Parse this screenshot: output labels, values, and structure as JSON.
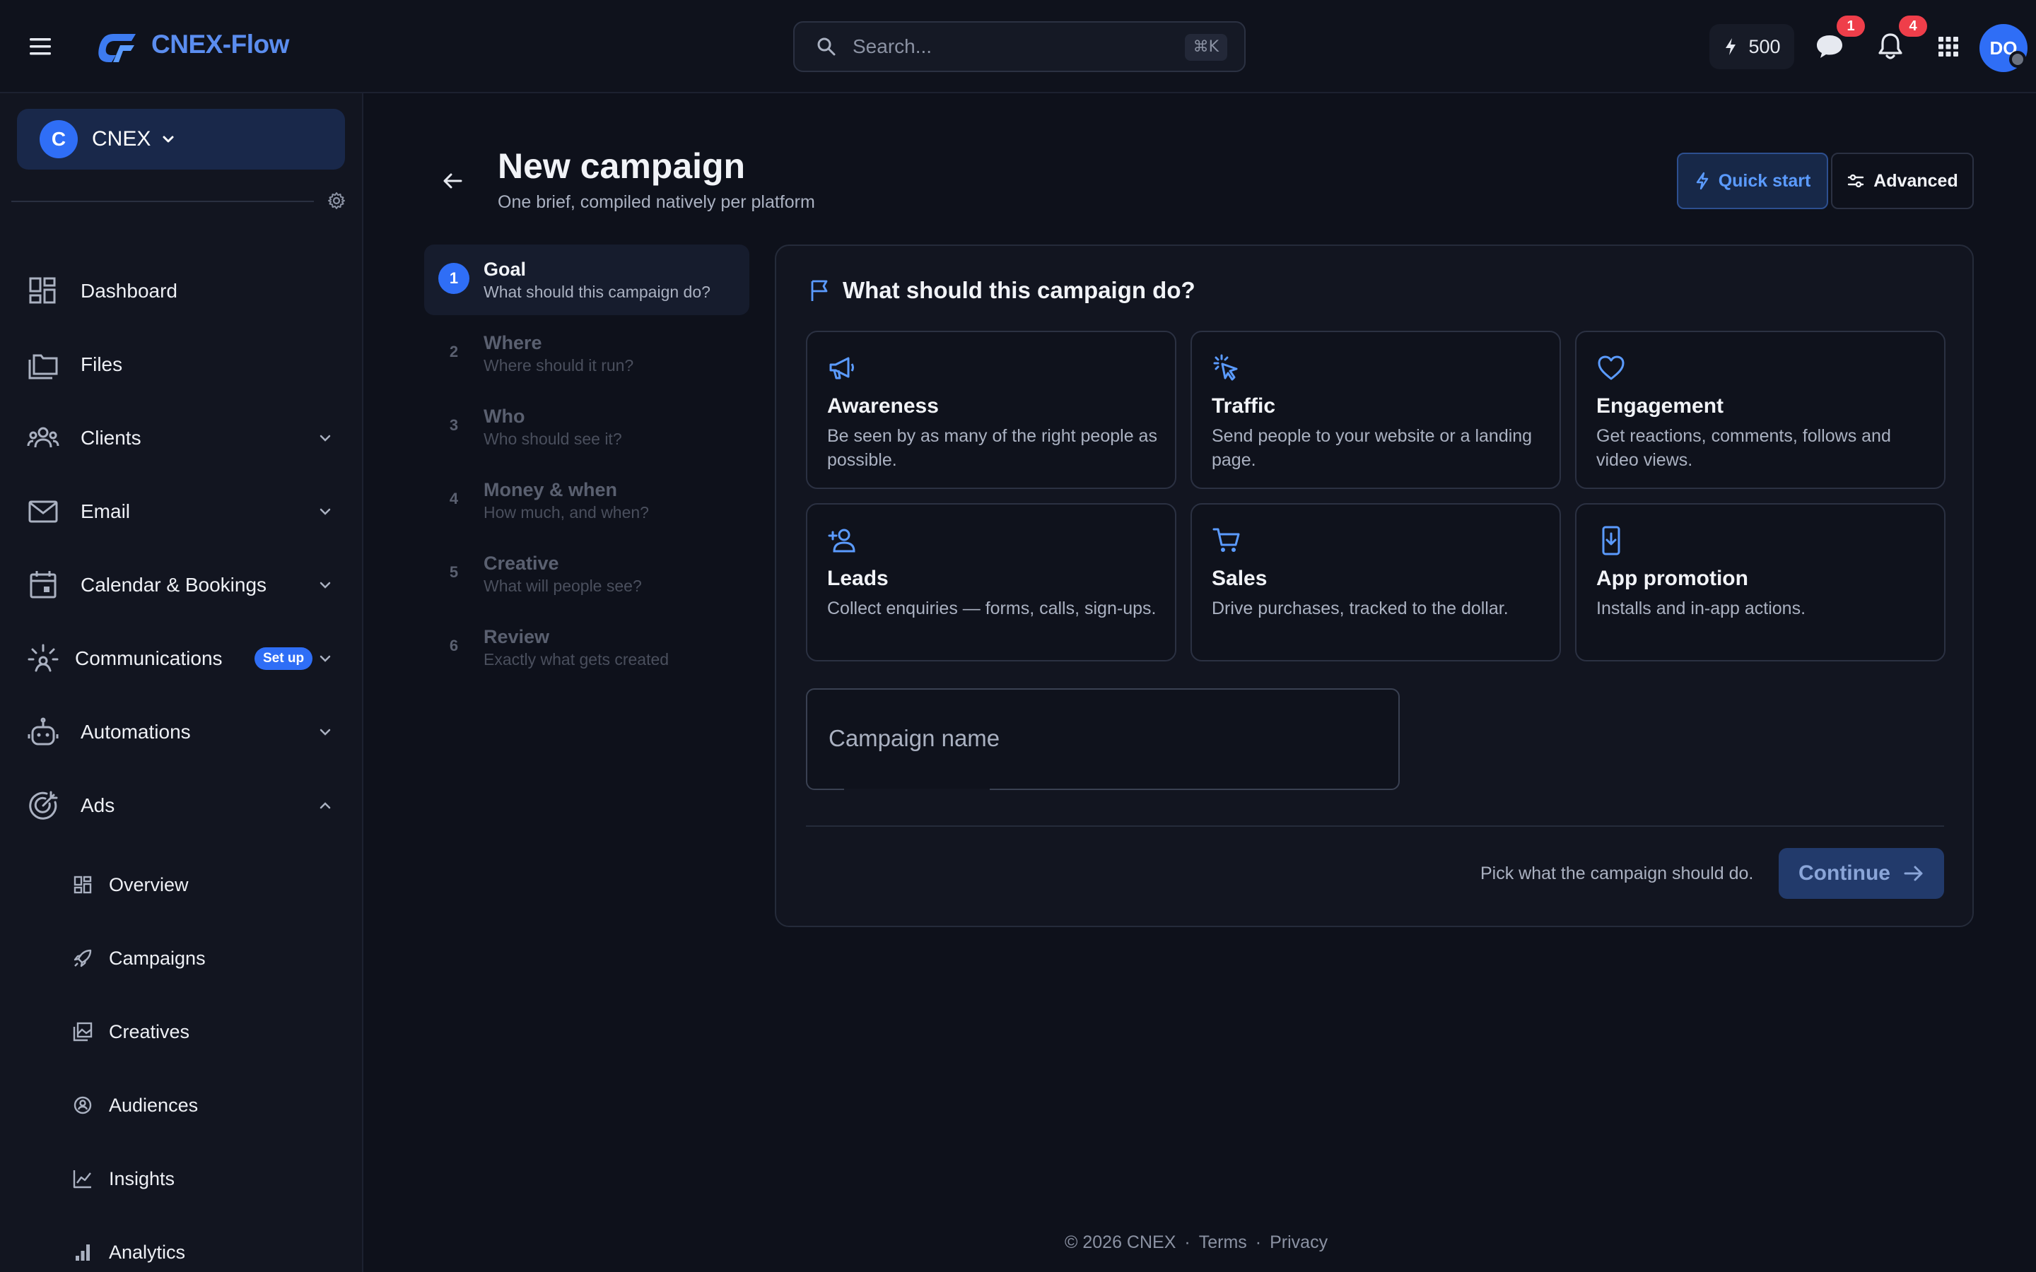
{
  "app": {
    "name": "CNEX-Flow",
    "brand_color": "#5b8def",
    "accent_color": "#2f6ef6"
  },
  "topbar": {
    "search_placeholder": "Search...",
    "search_shortcut": "⌘K",
    "credits": "500",
    "messages_badge": "1",
    "notifications_badge": "4",
    "user_initials": "DO"
  },
  "sidebar": {
    "org": {
      "initial": "C",
      "name": "CNEX"
    },
    "items": [
      {
        "label": "Dashboard",
        "icon": "dashboard-icon"
      },
      {
        "label": "Files",
        "icon": "folders-icon"
      },
      {
        "label": "Clients",
        "icon": "users-icon",
        "expandable": true
      },
      {
        "label": "Email",
        "icon": "mail-icon",
        "expandable": true
      },
      {
        "label": "Calendar & Bookings",
        "icon": "calendar-icon",
        "expandable": true
      },
      {
        "label": "Communications",
        "icon": "broadcast-icon",
        "expandable": true,
        "badge": "Set up"
      },
      {
        "label": "Automations",
        "icon": "robot-icon",
        "expandable": true
      },
      {
        "label": "Ads",
        "icon": "target-icon",
        "expanded": true
      }
    ],
    "ads_sub": [
      {
        "label": "Overview",
        "icon": "grid-icon"
      },
      {
        "label": "Campaigns",
        "icon": "rocket-icon"
      },
      {
        "label": "Creatives",
        "icon": "images-icon"
      },
      {
        "label": "Audiences",
        "icon": "audience-icon"
      },
      {
        "label": "Insights",
        "icon": "trend-icon"
      },
      {
        "label": "Analytics",
        "icon": "bars-icon"
      }
    ]
  },
  "page": {
    "title": "New campaign",
    "subtitle": "One brief, compiled natively per platform",
    "quick_start": "Quick start",
    "advanced": "Advanced"
  },
  "steps": [
    {
      "num": "1",
      "title": "Goal",
      "sub": "What should this campaign do?",
      "active": true
    },
    {
      "num": "2",
      "title": "Where",
      "sub": "Where should it run?"
    },
    {
      "num": "3",
      "title": "Who",
      "sub": "Who should see it?"
    },
    {
      "num": "4",
      "title": "Money & when",
      "sub": "How much, and when?"
    },
    {
      "num": "5",
      "title": "Creative",
      "sub": "What will people see?"
    },
    {
      "num": "6",
      "title": "Review",
      "sub": "Exactly what gets created"
    }
  ],
  "goal_panel": {
    "title": "What should this campaign do?",
    "goals": [
      {
        "title": "Awareness",
        "desc": "Be seen by as many of the right people as possible.",
        "icon": "megaphone-icon"
      },
      {
        "title": "Traffic",
        "desc": "Send people to your website or a landing page.",
        "icon": "click-icon"
      },
      {
        "title": "Engagement",
        "desc": "Get reactions, comments, follows and video views.",
        "icon": "heart-icon"
      },
      {
        "title": "Leads",
        "desc": "Collect enquiries — forms, calls, sign-ups.",
        "icon": "user-plus-icon"
      },
      {
        "title": "Sales",
        "desc": "Drive purchases, tracked to the dollar.",
        "icon": "cart-icon"
      },
      {
        "title": "App promotion",
        "desc": "Installs and in-app actions.",
        "icon": "phone-download-icon"
      }
    ],
    "campaign_name_label": "Campaign name",
    "hint": "Pick what the campaign should do.",
    "continue": "Continue"
  },
  "footer": {
    "copyright": "© 2026 CNEX",
    "terms": "Terms",
    "privacy": "Privacy",
    "separator": "·"
  }
}
